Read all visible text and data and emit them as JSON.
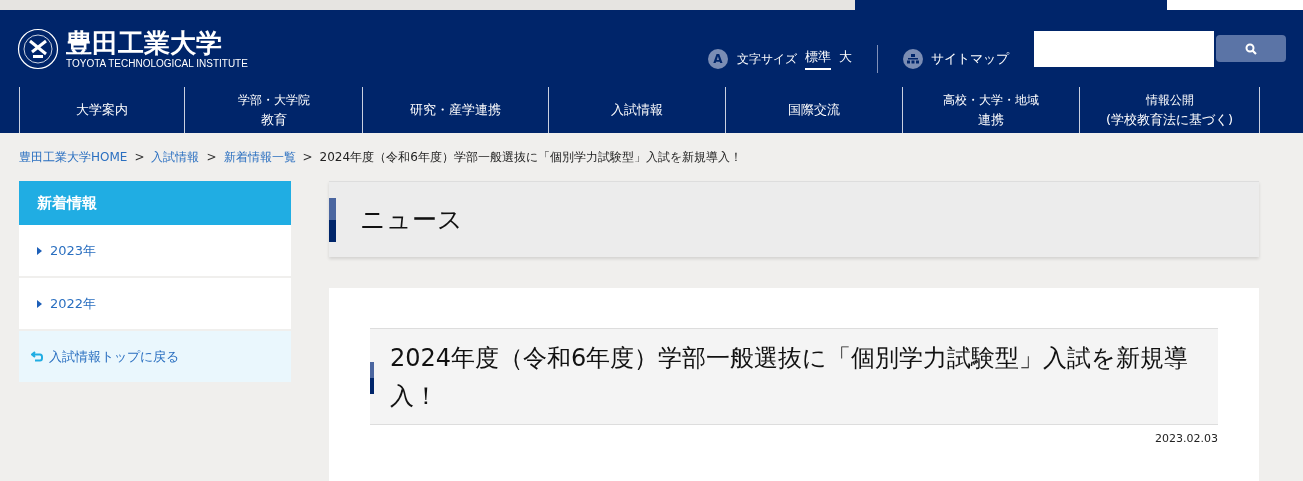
{
  "header": {
    "logo_title": "豊田工業大学",
    "logo_subtitle": "TOYOTA TECHNOLOGICAL INSTITUTE",
    "font_size": {
      "icon": "A",
      "label": "文字サイズ",
      "options": [
        {
          "label": "標準",
          "selected": true
        },
        {
          "label": "大",
          "selected": false
        }
      ]
    },
    "sitemap": "サイトマップ"
  },
  "nav": [
    {
      "lines": [
        "大学案内"
      ]
    },
    {
      "lines": [
        "学部・大学院",
        "教育"
      ]
    },
    {
      "lines": [
        "研究・産学連携"
      ]
    },
    {
      "lines": [
        "入試情報"
      ]
    },
    {
      "lines": [
        "国際交流"
      ]
    },
    {
      "lines": [
        "高校・大学・地域",
        "連携"
      ]
    },
    {
      "lines": [
        "情報公開",
        "(学校教育法に基づく)"
      ]
    }
  ],
  "breadcrumb": {
    "separators": [
      ">",
      ">",
      ">"
    ],
    "links": [
      "豊田工業大学HOME",
      "入試情報",
      "新着情報一覧"
    ],
    "current": "2024年度（令和6年度）学部一般選抜に「個別学力試験型」入試を新規導入！"
  },
  "sidebar": {
    "title": "新着情報",
    "items": [
      "2023年",
      "2022年"
    ],
    "back": "入試情報トップに戻る"
  },
  "main": {
    "section_title": "ニュース",
    "article_title": "2024年度（令和6年度）学部一般選抜に「個別学力試験型」入試を新規導入！",
    "date": "2023.02.03"
  }
}
